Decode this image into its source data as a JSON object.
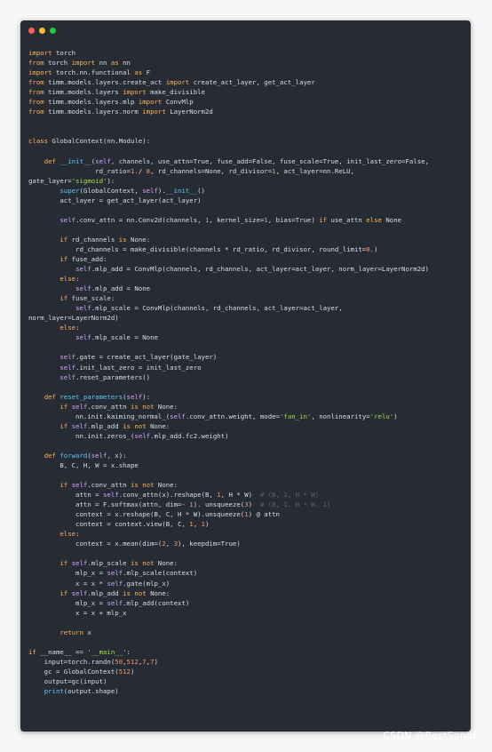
{
  "window": {
    "traffic_lights": [
      {
        "name": "close",
        "color": "#ff5f56"
      },
      {
        "name": "minimize",
        "color": "#ffbd2e"
      },
      {
        "name": "maximize",
        "color": "#27c93f"
      }
    ]
  },
  "code": {
    "lines": [
      [
        [
          "kw",
          "import"
        ],
        [
          "",
          "torch"
        ]
      ],
      [
        [
          "kw",
          "from"
        ],
        [
          "",
          "torch"
        ],
        [
          "kw",
          "import"
        ],
        [
          "",
          "nn"
        ],
        [
          "kw",
          "as"
        ],
        [
          "",
          "nn"
        ]
      ],
      [
        [
          "kw",
          "import"
        ],
        [
          "",
          "torch.nn.functional"
        ],
        [
          "kw",
          "as"
        ],
        [
          "",
          "F"
        ]
      ],
      [
        [
          "kw",
          "from"
        ],
        [
          "",
          "timm.models.layers.create_act"
        ],
        [
          "kw",
          "import"
        ],
        [
          "",
          "create_act_layer, get_act_layer"
        ]
      ],
      [
        [
          "kw",
          "from"
        ],
        [
          "",
          "timm.models.layers"
        ],
        [
          "kw",
          "import"
        ],
        [
          "",
          "make_divisible"
        ]
      ],
      [
        [
          "kw",
          "from"
        ],
        [
          "",
          "timm.models.layers.mlp"
        ],
        [
          "kw",
          "import"
        ],
        [
          "",
          "ConvMlp"
        ]
      ],
      [
        [
          "kw",
          "from"
        ],
        [
          "",
          "timm.models.layers.norm"
        ],
        [
          "kw",
          "import"
        ],
        [
          "",
          "LayerNorm2d"
        ]
      ],
      [],
      [],
      [
        [
          "kw",
          "class"
        ],
        [
          "",
          "GlobalContext(nn.Module):"
        ]
      ],
      [],
      [
        [
          "",
          "    "
        ],
        [
          "kw",
          "def"
        ],
        [
          "fn",
          "__init__"
        ],
        [
          "",
          "("
        ],
        [
          "self",
          "self"
        ],
        [
          "",
          ", channels, use_attn=True, fuse_add=False, fuse_scale=True, init_last_zero=False,"
        ]
      ],
      [
        [
          "",
          "                 rd_ratio="
        ],
        [
          "num",
          "1."
        ],
        [
          "",
          "/"
        ],
        [
          "num",
          "8"
        ],
        [
          "",
          ", rd_channels=None, rd_divisor="
        ],
        [
          "num",
          "1"
        ],
        [
          "",
          ", act_layer=nn.ReLU,"
        ]
      ],
      [
        [
          "",
          "gate_layer="
        ],
        [
          "str",
          "'sigmoid'"
        ],
        [
          "",
          "):"
        ]
      ],
      [
        [
          "",
          "        "
        ],
        [
          "fn",
          "super"
        ],
        [
          "",
          "(GlobalContext, "
        ],
        [
          "self",
          "self"
        ],
        [
          "",
          ")."
        ],
        [
          "fn",
          "__init__"
        ],
        [
          "",
          "()"
        ]
      ],
      [
        [
          "",
          "        act_layer = get_act_layer(act_layer)"
        ]
      ],
      [],
      [
        [
          "",
          "        "
        ],
        [
          "self",
          "self"
        ],
        [
          "",
          ".conv_attn = nn.Conv2d(channels, "
        ],
        [
          "num",
          "1"
        ],
        [
          "",
          ", kernel_size="
        ],
        [
          "num",
          "1"
        ],
        [
          "",
          ", bias=True) "
        ],
        [
          "kw",
          "if"
        ],
        [
          "",
          ""
        ],
        [
          "",
          "use_attn "
        ],
        [
          "kw",
          "else"
        ],
        [
          "",
          "None"
        ]
      ],
      [],
      [
        [
          "",
          "        "
        ],
        [
          "kw",
          "if"
        ],
        [
          "",
          "rd_channels "
        ],
        [
          "kw",
          "is"
        ],
        [
          "",
          "None:"
        ]
      ],
      [
        [
          "",
          "            rd_channels = make_divisible(channels * rd_ratio, rd_divisor, round_limit="
        ],
        [
          "num",
          "0."
        ],
        [
          "",
          ")"
        ]
      ],
      [
        [
          "",
          "        "
        ],
        [
          "kw",
          "if"
        ],
        [
          "",
          "fuse_add:"
        ]
      ],
      [
        [
          "",
          "            "
        ],
        [
          "self",
          "self"
        ],
        [
          "",
          ".mlp_add = ConvMlp(channels, rd_channels, act_layer=act_layer, norm_layer=LayerNorm2d)"
        ]
      ],
      [
        [
          "",
          "        "
        ],
        [
          "kw",
          "else"
        ],
        [
          "",
          ":"
        ]
      ],
      [
        [
          "",
          "            "
        ],
        [
          "self",
          "self"
        ],
        [
          "",
          ".mlp_add = None"
        ]
      ],
      [
        [
          "",
          "        "
        ],
        [
          "kw",
          "if"
        ],
        [
          "",
          "fuse_scale:"
        ]
      ],
      [
        [
          "",
          "            "
        ],
        [
          "self",
          "self"
        ],
        [
          "",
          ".mlp_scale = ConvMlp(channels, rd_channels, act_layer=act_layer,"
        ]
      ],
      [
        [
          "",
          "norm_layer=LayerNorm2d)"
        ]
      ],
      [
        [
          "",
          "        "
        ],
        [
          "kw",
          "else"
        ],
        [
          "",
          ":"
        ]
      ],
      [
        [
          "",
          "            "
        ],
        [
          "self",
          "self"
        ],
        [
          "",
          ".mlp_scale = None"
        ]
      ],
      [],
      [
        [
          "",
          "        "
        ],
        [
          "self",
          "self"
        ],
        [
          "",
          ".gate = create_act_layer(gate_layer)"
        ]
      ],
      [
        [
          "",
          "        "
        ],
        [
          "self",
          "self"
        ],
        [
          "",
          ".init_last_zero = init_last_zero"
        ]
      ],
      [
        [
          "",
          "        "
        ],
        [
          "self",
          "self"
        ],
        [
          "",
          ".reset_parameters()"
        ]
      ],
      [],
      [
        [
          "",
          "    "
        ],
        [
          "kw",
          "def"
        ],
        [
          "fn",
          "reset_parameters"
        ],
        [
          "",
          "("
        ],
        [
          "self",
          "self"
        ],
        [
          "",
          "):"
        ]
      ],
      [
        [
          "",
          "        "
        ],
        [
          "kw",
          "if"
        ],
        [
          "self",
          "self"
        ],
        [
          "",
          ".conv_attn "
        ],
        [
          "kw",
          "is not"
        ],
        [
          "",
          "None:"
        ]
      ],
      [
        [
          "",
          "            nn.init.kaiming_normal_("
        ],
        [
          "self",
          "self"
        ],
        [
          "",
          ".conv_attn.weight, mode="
        ],
        [
          "str",
          "'fan_in'"
        ],
        [
          "",
          ", nonlinearity="
        ],
        [
          "str",
          "'relu'"
        ],
        [
          "",
          ")"
        ]
      ],
      [
        [
          "",
          "        "
        ],
        [
          "kw",
          "if"
        ],
        [
          "self",
          "self"
        ],
        [
          "",
          ".mlp_add "
        ],
        [
          "kw",
          "is not"
        ],
        [
          "",
          "None:"
        ]
      ],
      [
        [
          "",
          "            nn.init.zeros_("
        ],
        [
          "self",
          "self"
        ],
        [
          "",
          ".mlp_add.fc2.weight)"
        ]
      ],
      [],
      [
        [
          "",
          "    "
        ],
        [
          "kw",
          "def"
        ],
        [
          "fn",
          "forward"
        ],
        [
          "",
          "("
        ],
        [
          "self",
          "self"
        ],
        [
          "",
          ", x):"
        ]
      ],
      [
        [
          "",
          "        B, C, H, W = x.shape"
        ]
      ],
      [],
      [
        [
          "",
          "        "
        ],
        [
          "kw",
          "if"
        ],
        [
          "self",
          "self"
        ],
        [
          "",
          ".conv_attn "
        ],
        [
          "kw",
          "is not"
        ],
        [
          "",
          "None:"
        ]
      ],
      [
        [
          "",
          "            attn = "
        ],
        [
          "self",
          "self"
        ],
        [
          "",
          ".conv_attn(x).reshape(B, "
        ],
        [
          "num",
          "1"
        ],
        [
          "",
          ", H * W)  "
        ],
        [
          "cm",
          "# (B, 1, H * W)"
        ]
      ],
      [
        [
          "",
          "            attn = F.softmax(attn, dim=-"
        ],
        [
          "num",
          "1"
        ],
        [
          "",
          "). unsqueeze("
        ],
        [
          "num",
          "3"
        ],
        [
          "",
          ")  "
        ],
        [
          "cm",
          "# (B, 1, H * W, 1)"
        ]
      ],
      [
        [
          "",
          "            context = x.reshape(B, C, H * W).unsqueeze("
        ],
        [
          "num",
          "1"
        ],
        [
          "",
          ") @ attn"
        ]
      ],
      [
        [
          "",
          "            context = context.view(B, C, "
        ],
        [
          "num",
          "1"
        ],
        [
          "",
          ", "
        ],
        [
          "num",
          "1"
        ],
        [
          "",
          ")"
        ]
      ],
      [
        [
          "",
          "        "
        ],
        [
          "kw",
          "else"
        ],
        [
          "",
          ":"
        ]
      ],
      [
        [
          "",
          "            context = x.mean(dim=("
        ],
        [
          "num",
          "2"
        ],
        [
          "",
          ", "
        ],
        [
          "num",
          "3"
        ],
        [
          "",
          "), keepdim=True)"
        ]
      ],
      [],
      [
        [
          "",
          "        "
        ],
        [
          "kw",
          "if"
        ],
        [
          "self",
          "self"
        ],
        [
          "",
          ".mlp_scale "
        ],
        [
          "kw",
          "is not"
        ],
        [
          "",
          "None:"
        ]
      ],
      [
        [
          "",
          "            mlp_x = "
        ],
        [
          "self",
          "self"
        ],
        [
          "",
          ".mlp_scale(context)"
        ]
      ],
      [
        [
          "",
          "            x = x * "
        ],
        [
          "self",
          "self"
        ],
        [
          "",
          ".gate(mlp_x)"
        ]
      ],
      [
        [
          "",
          "        "
        ],
        [
          "kw",
          "if"
        ],
        [
          "self",
          "self"
        ],
        [
          "",
          ".mlp_add "
        ],
        [
          "kw",
          "is not"
        ],
        [
          "",
          "None:"
        ]
      ],
      [
        [
          "",
          "            mlp_x = "
        ],
        [
          "self",
          "self"
        ],
        [
          "",
          ".mlp_add(context)"
        ]
      ],
      [
        [
          "",
          "            x = x + mlp_x"
        ]
      ],
      [],
      [
        [
          "",
          "        "
        ],
        [
          "kw",
          "return"
        ],
        [
          "",
          "x"
        ]
      ],
      [],
      [
        [
          "kw",
          "if"
        ],
        [
          "",
          "__name__ == "
        ],
        [
          "str",
          "'__main__'"
        ],
        [
          "",
          ":"
        ]
      ],
      [
        [
          "",
          "    input=torch.randn("
        ],
        [
          "num",
          "50"
        ],
        [
          "",
          ","
        ],
        [
          "num",
          "512"
        ],
        [
          "",
          ","
        ],
        [
          "num",
          "7"
        ],
        [
          "",
          ","
        ],
        [
          "num",
          "7"
        ],
        [
          "",
          ")"
        ]
      ],
      [
        [
          "",
          "    gc = GlobalContext("
        ],
        [
          "num",
          "512"
        ],
        [
          "",
          ")"
        ]
      ],
      [
        [
          "",
          "    output=gc(input)"
        ]
      ],
      [
        [
          "",
          "    "
        ],
        [
          "fn",
          "print"
        ],
        [
          "",
          "(output.shape)"
        ]
      ]
    ]
  },
  "watermark": "CSDN @BestSongC"
}
